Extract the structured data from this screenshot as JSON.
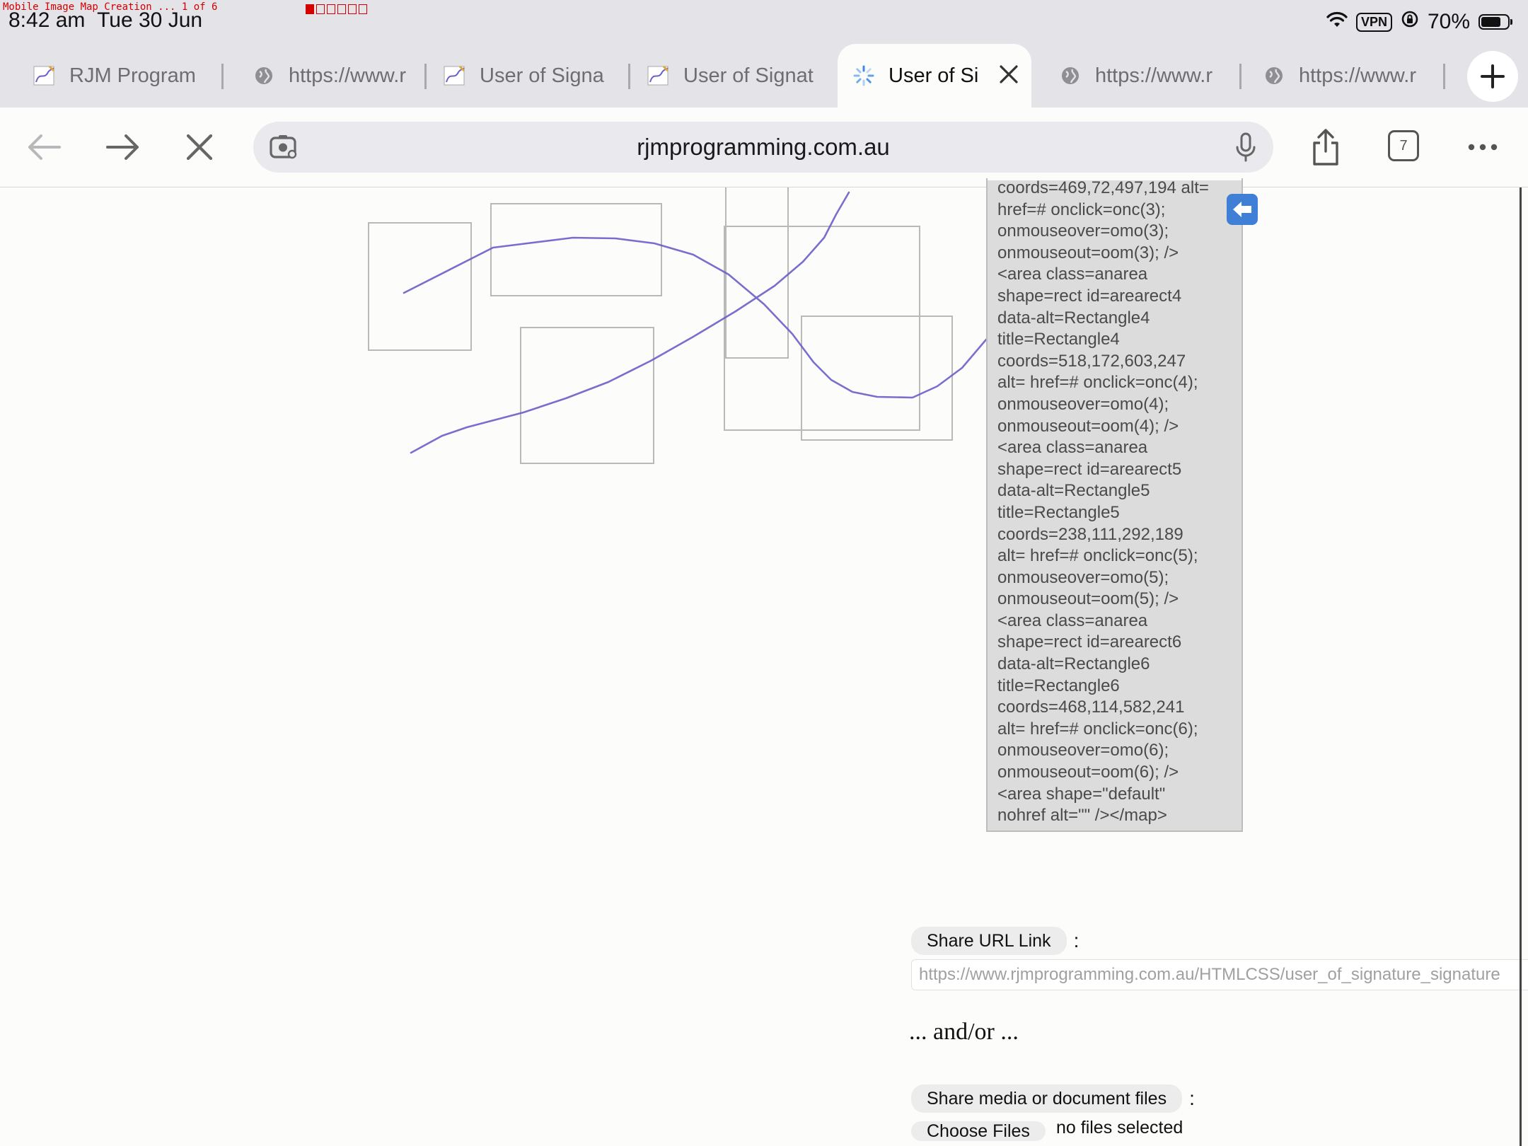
{
  "status_bar": {
    "recording_title": "Mobile Image Map Creation ... 1 of 6",
    "recording_progress": {
      "current": 1,
      "total": 6
    },
    "time": "8:42 am",
    "date": "Tue 30 Jun",
    "vpn_label": "VPN",
    "battery_percent": "70%",
    "battery_level": 0.7
  },
  "tabs": [
    {
      "label": "RJM Program",
      "favicon": "signature-icon",
      "active": false
    },
    {
      "label": "https://www.r",
      "favicon": "globe-icon",
      "active": false
    },
    {
      "label": "User of Signa",
      "favicon": "signature-icon",
      "active": false
    },
    {
      "label": "User of Signat",
      "favicon": "signature-icon",
      "active": false
    },
    {
      "label": "User of Si",
      "favicon": "loading-spinner-icon",
      "active": true
    },
    {
      "label": "https://www.r",
      "favicon": "globe-icon",
      "active": false
    },
    {
      "label": "https://www.r",
      "favicon": "globe-icon",
      "active": false
    }
  ],
  "toolbar": {
    "url": "rjmprogramming.com.au",
    "tab_count": "7"
  },
  "code_lines": [
    "coords=469,72,497,194  alt=",
    "href=# onclick=onc(3);",
    "onmouseover=omo(3);",
    "onmouseout=oom(3); />",
    "<area class=anarea",
    "shape=rect id=arearect4",
    "data-alt=Rectangle4",
    "title=Rectangle4",
    "coords=518,172,603,247",
    "alt= href=# onclick=onc(4);",
    "onmouseover=omo(4);",
    "onmouseout=oom(4); />",
    "<area class=anarea",
    "shape=rect id=arearect5",
    "data-alt=Rectangle5",
    "title=Rectangle5",
    "coords=238,111,292,189",
    "alt= href=# onclick=onc(5);",
    "onmouseover=omo(5);",
    "onmouseout=oom(5); />",
    "<area class=anarea",
    "shape=rect id=arearect6",
    "data-alt=Rectangle6",
    "title=Rectangle6",
    "coords=468,114,582,241",
    "alt= href=# onclick=onc(6);",
    "onmouseover=omo(6);",
    "onmouseout=oom(6); />",
    "<area shape=\"default\"",
    "nohref alt=\"\" /></map>"
  ],
  "share": {
    "url_button": "Share URL Link",
    "colon": ":",
    "url_value": "https://www.rjmprogramming.com.au/HTMLCSS/user_of_signature_signature",
    "and_or": "... and/or ...",
    "files_button": "Share media or document files",
    "choose_files": "Choose Files",
    "no_files": "no files selected"
  },
  "colors": {
    "signature_stroke": "#6b5fc9",
    "recording_red": "#d40000",
    "panel_bg": "#dcdcdc"
  }
}
